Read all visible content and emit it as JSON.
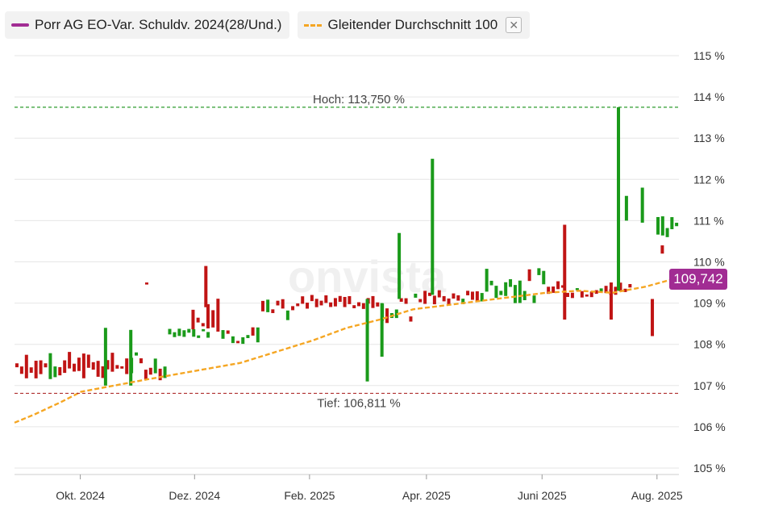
{
  "legend": {
    "series_label": "Porr AG EO-Var. Schuldv. 2024(28/Und.)",
    "series_color": "#a12c93",
    "ma_label": "Gleitender Durchschnitt 100",
    "ma_color": "#f5a623",
    "close_icon": "close-icon"
  },
  "watermark": "onvista",
  "last_price_label": "109,742",
  "high_label": "Hoch: 113,750 %",
  "low_label": "Tief: 106,811 %",
  "colors": {
    "up": "#1a9a1a",
    "down": "#c01414",
    "grid": "#e6e6e6",
    "high_line": "#2e9b2e",
    "low_line": "#b03030"
  },
  "chart_data": {
    "type": "candlestick",
    "ylim": [
      105,
      115
    ],
    "y_ticks": [
      105,
      106,
      107,
      108,
      109,
      110,
      111,
      112,
      113,
      114,
      115
    ],
    "y_tick_labels": [
      "105 %",
      "106 %",
      "107 %",
      "108 %",
      "109 %",
      "110 %",
      "111 %",
      "112 %",
      "113 %",
      "114 %",
      "115 %"
    ],
    "x_ticks": [
      "Okt. 2024",
      "Dez. 2024",
      "Feb. 2025",
      "Apr. 2025",
      "Juni 2025",
      "Aug. 2025"
    ],
    "x_tick_pos": [
      0.099,
      0.271,
      0.444,
      0.62,
      0.794,
      0.967
    ],
    "high": 113.75,
    "low": 106.811,
    "last": 109.742,
    "segments": [
      {
        "from": 0.0,
        "to": 0.23,
        "base": 107.45,
        "spread": 0.65,
        "bias": "down"
      },
      {
        "from": 0.23,
        "to": 0.295,
        "base": 108.25,
        "spread": 0.2,
        "bias": "up"
      },
      {
        "from": 0.265,
        "to": 0.31,
        "base": 108.8,
        "spread": 1.0,
        "bias": "down"
      },
      {
        "from": 0.31,
        "to": 0.37,
        "base": 108.2,
        "spread": 0.4,
        "bias": "mixed"
      },
      {
        "from": 0.37,
        "to": 0.43,
        "base": 108.8,
        "spread": 0.5,
        "bias": "down"
      },
      {
        "from": 0.43,
        "to": 0.55,
        "base": 109.0,
        "spread": 0.3,
        "bias": "down"
      },
      {
        "from": 0.55,
        "to": 0.6,
        "base": 108.8,
        "spread": 0.6,
        "bias": "mixed"
      },
      {
        "from": 0.6,
        "to": 0.7,
        "base": 109.1,
        "spread": 0.35,
        "bias": "down"
      },
      {
        "from": 0.7,
        "to": 0.8,
        "base": 109.4,
        "spread": 0.8,
        "bias": "up"
      },
      {
        "from": 0.8,
        "to": 0.93,
        "base": 109.3,
        "spread": 0.4,
        "bias": "down"
      },
      {
        "from": 0.965,
        "to": 1.0,
        "base": 110.9,
        "spread": 0.6,
        "bias": "up"
      }
    ],
    "spikes": [
      {
        "t": 0.137,
        "low": 107.0,
        "high": 108.4,
        "dir": "up"
      },
      {
        "t": 0.175,
        "low": 107.0,
        "high": 108.35,
        "dir": "up"
      },
      {
        "t": 0.199,
        "low": 109.45,
        "high": 109.5,
        "dir": "down"
      },
      {
        "t": 0.288,
        "low": 108.9,
        "high": 109.9,
        "dir": "down"
      },
      {
        "t": 0.531,
        "low": 107.1,
        "high": 109.1,
        "dir": "up"
      },
      {
        "t": 0.553,
        "low": 107.7,
        "high": 109.0,
        "dir": "up"
      },
      {
        "t": 0.579,
        "low": 109.1,
        "high": 110.7,
        "dir": "up"
      },
      {
        "t": 0.629,
        "low": 109.2,
        "high": 112.5,
        "dir": "up"
      },
      {
        "t": 0.828,
        "low": 108.6,
        "high": 110.9,
        "dir": "down"
      },
      {
        "t": 0.898,
        "low": 108.6,
        "high": 109.5,
        "dir": "down"
      },
      {
        "t": 0.909,
        "low": 109.3,
        "high": 113.75,
        "dir": "up"
      },
      {
        "t": 0.921,
        "low": 111.0,
        "high": 111.6,
        "dir": "up"
      },
      {
        "t": 0.945,
        "low": 110.95,
        "high": 111.8,
        "dir": "up"
      },
      {
        "t": 0.96,
        "low": 108.2,
        "high": 109.1,
        "dir": "down"
      },
      {
        "t": 0.975,
        "low": 110.2,
        "high": 110.4,
        "dir": "down"
      }
    ],
    "moving_average": [
      [
        0.0,
        106.1
      ],
      [
        0.03,
        106.3
      ],
      [
        0.07,
        106.6
      ],
      [
        0.1,
        106.85
      ],
      [
        0.15,
        107.0
      ],
      [
        0.2,
        107.15
      ],
      [
        0.27,
        107.35
      ],
      [
        0.34,
        107.55
      ],
      [
        0.4,
        107.85
      ],
      [
        0.45,
        108.1
      ],
      [
        0.5,
        108.4
      ],
      [
        0.55,
        108.6
      ],
      [
        0.6,
        108.85
      ],
      [
        0.65,
        108.95
      ],
      [
        0.7,
        109.05
      ],
      [
        0.75,
        109.15
      ],
      [
        0.8,
        109.25
      ],
      [
        0.85,
        109.3
      ],
      [
        0.9,
        109.25
      ],
      [
        0.95,
        109.4
      ],
      [
        1.0,
        109.62
      ]
    ]
  }
}
